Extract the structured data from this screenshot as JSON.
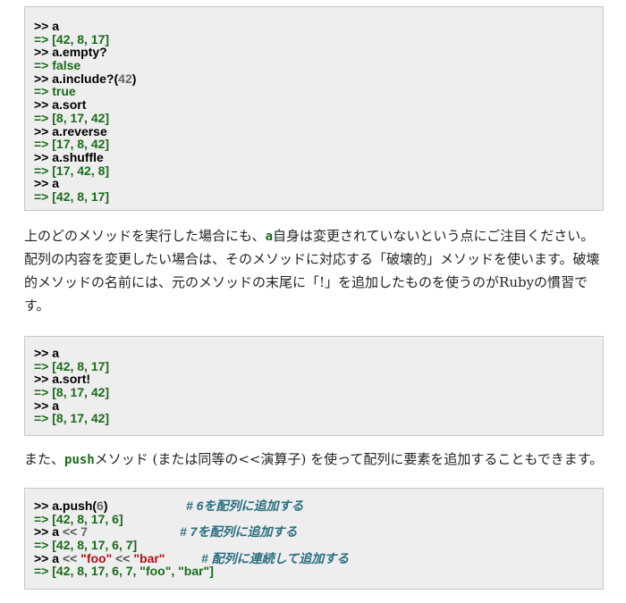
{
  "block1": [
    {
      "p": ">>",
      "code": "a"
    },
    {
      "p": "=>",
      "code": "[42, 8, 17]"
    },
    {
      "p": ">>",
      "code": "a.empty?"
    },
    {
      "p": "=>",
      "code": "false"
    },
    {
      "p": ">>",
      "code": "a.include?(",
      "num": "42",
      "tail": ")"
    },
    {
      "p": "=>",
      "code": "true"
    },
    {
      "p": ">>",
      "code": "a.sort"
    },
    {
      "p": "=>",
      "code": "[8, 17, 42]"
    },
    {
      "p": ">>",
      "code": "a.reverse"
    },
    {
      "p": "=>",
      "code": "[17, 8, 42]"
    },
    {
      "p": ">>",
      "code": "a.shuffle"
    },
    {
      "p": "=>",
      "code": "[17, 42, 8]"
    },
    {
      "p": ">>",
      "code": "a"
    },
    {
      "p": "=>",
      "code": "[42, 8, 17]"
    }
  ],
  "para1": {
    "line1_pre": "上のどのメソッドを実行した場合にも、",
    "line1_code": "a",
    "line1_post": "自身は変更されていないという点にご注目ください。",
    "line2": "配列の内容を変更したい場合は、そのメソッドに対応する「破壊的」メソッドを使います。破壊",
    "line3": "的メソッドの名前には、元のメソッドの末尾に「!」を追加したものを使うのがRubyの慣習で",
    "line4": "す。"
  },
  "block2": [
    {
      "p": ">>",
      "code": "a"
    },
    {
      "p": "=>",
      "code": "[42, 8, 17]"
    },
    {
      "p": ">>",
      "code": "a.sort!"
    },
    {
      "p": "=>",
      "code": "[8, 17, 42]"
    },
    {
      "p": ">>",
      "code": "a"
    },
    {
      "p": "=>",
      "code": "[8, 17, 42]"
    }
  ],
  "para2": {
    "pre": "また、",
    "code": "push",
    "post": "メソッド (または同等の<<演算子) を使って配列に要素を追加することもできます。"
  },
  "block3": {
    "l1_p": ">>",
    "l1_code": "a.push(",
    "l1_num": "6",
    "l1_tail": ")",
    "l1_comment": "# 6を配列に追加する",
    "l2_p": "=>",
    "l2_code": "[42, 8, 17, 6]",
    "l3_p": ">>",
    "l3_code": "a ",
    "l3_op": "<<",
    "l3_num": " 7",
    "l3_comment": "# 7を配列に追加する",
    "l4_p": "=>",
    "l4_code": "[42, 8, 17, 6, 7]",
    "l5_p": ">>",
    "l5_code": "a ",
    "l5_op1": "<<",
    "l5_s1": " \"foo\" ",
    "l5_op2": "<<",
    "l5_s2": " \"bar\"",
    "l5_comment": "# 配列に連続して追加する",
    "l6_p": "=>",
    "l6_code": "[42, 8, 17, 6, 7, \"foo\", \"bar\"]"
  }
}
